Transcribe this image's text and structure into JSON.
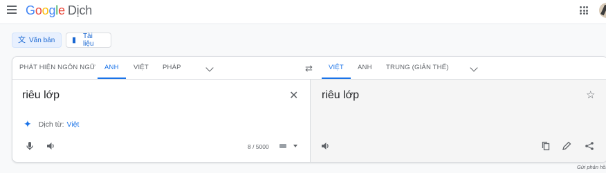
{
  "header": {
    "logo_google": "Google",
    "logo_product": "Dịch",
    "menu_icon": "hamburger-icon",
    "apps_icon": "apps-grid-icon"
  },
  "modes": [
    {
      "label": "Văn bản",
      "icon": "translate-icon",
      "active": true
    },
    {
      "label": "Tài liệu",
      "icon": "document-icon",
      "active": false
    }
  ],
  "source_langs": [
    "PHÁT HIỆN NGÔN NGỮ",
    "ANH",
    "VIỆT",
    "PHÁP"
  ],
  "source_active": "ANH",
  "target_langs": [
    "VIỆT",
    "ANH",
    "TRUNG (GIẢN THỂ)"
  ],
  "target_active": "VIỆT",
  "source": {
    "text": "riêu lớp",
    "detect_label": "Dịch từ:",
    "detect_lang": "Việt",
    "char_count": "8 / 5000"
  },
  "target": {
    "text": "riêu lớp"
  },
  "footer": {
    "feedback": "Gửi phản hồi"
  },
  "colors": {
    "accent": "#1a73e8",
    "active_mode_bg": "#e8f0fe"
  }
}
